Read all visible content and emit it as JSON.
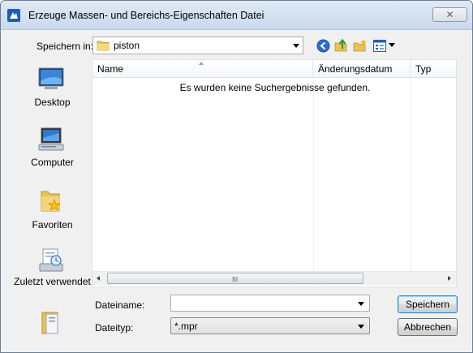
{
  "window": {
    "title": "Erzeuge Massen- und Bereichs-Eigenschaften Datei",
    "close_symbol": "✕",
    "app_icon": "app-logo-icon"
  },
  "toolbar": {
    "save_in_label": "Speichern in:",
    "current_folder": "piston",
    "icons": [
      "back-icon",
      "up-folder-icon",
      "new-folder-icon",
      "view-menu-icon"
    ]
  },
  "places": [
    {
      "label": "Desktop",
      "icon": "desktop-icon"
    },
    {
      "label": "Computer",
      "icon": "computer-icon"
    },
    {
      "label": "Favoriten",
      "icon": "favorites-icon"
    },
    {
      "label": "Zuletzt verwendet",
      "icon": "recent-icon"
    },
    {
      "label": "",
      "icon": "libraries-icon"
    }
  ],
  "filelist": {
    "columns": [
      "Name",
      "Änderungsdatum",
      "Typ"
    ],
    "empty_message": "Es wurden keine Suchergebnisse gefunden.",
    "scroll_grip": "III"
  },
  "form": {
    "filename_label": "Dateiname:",
    "filename_value": "",
    "filetype_label": "Dateityp:",
    "filetype_value": "*.mpr",
    "save_button": "Speichern",
    "cancel_button": "Abbrechen"
  }
}
